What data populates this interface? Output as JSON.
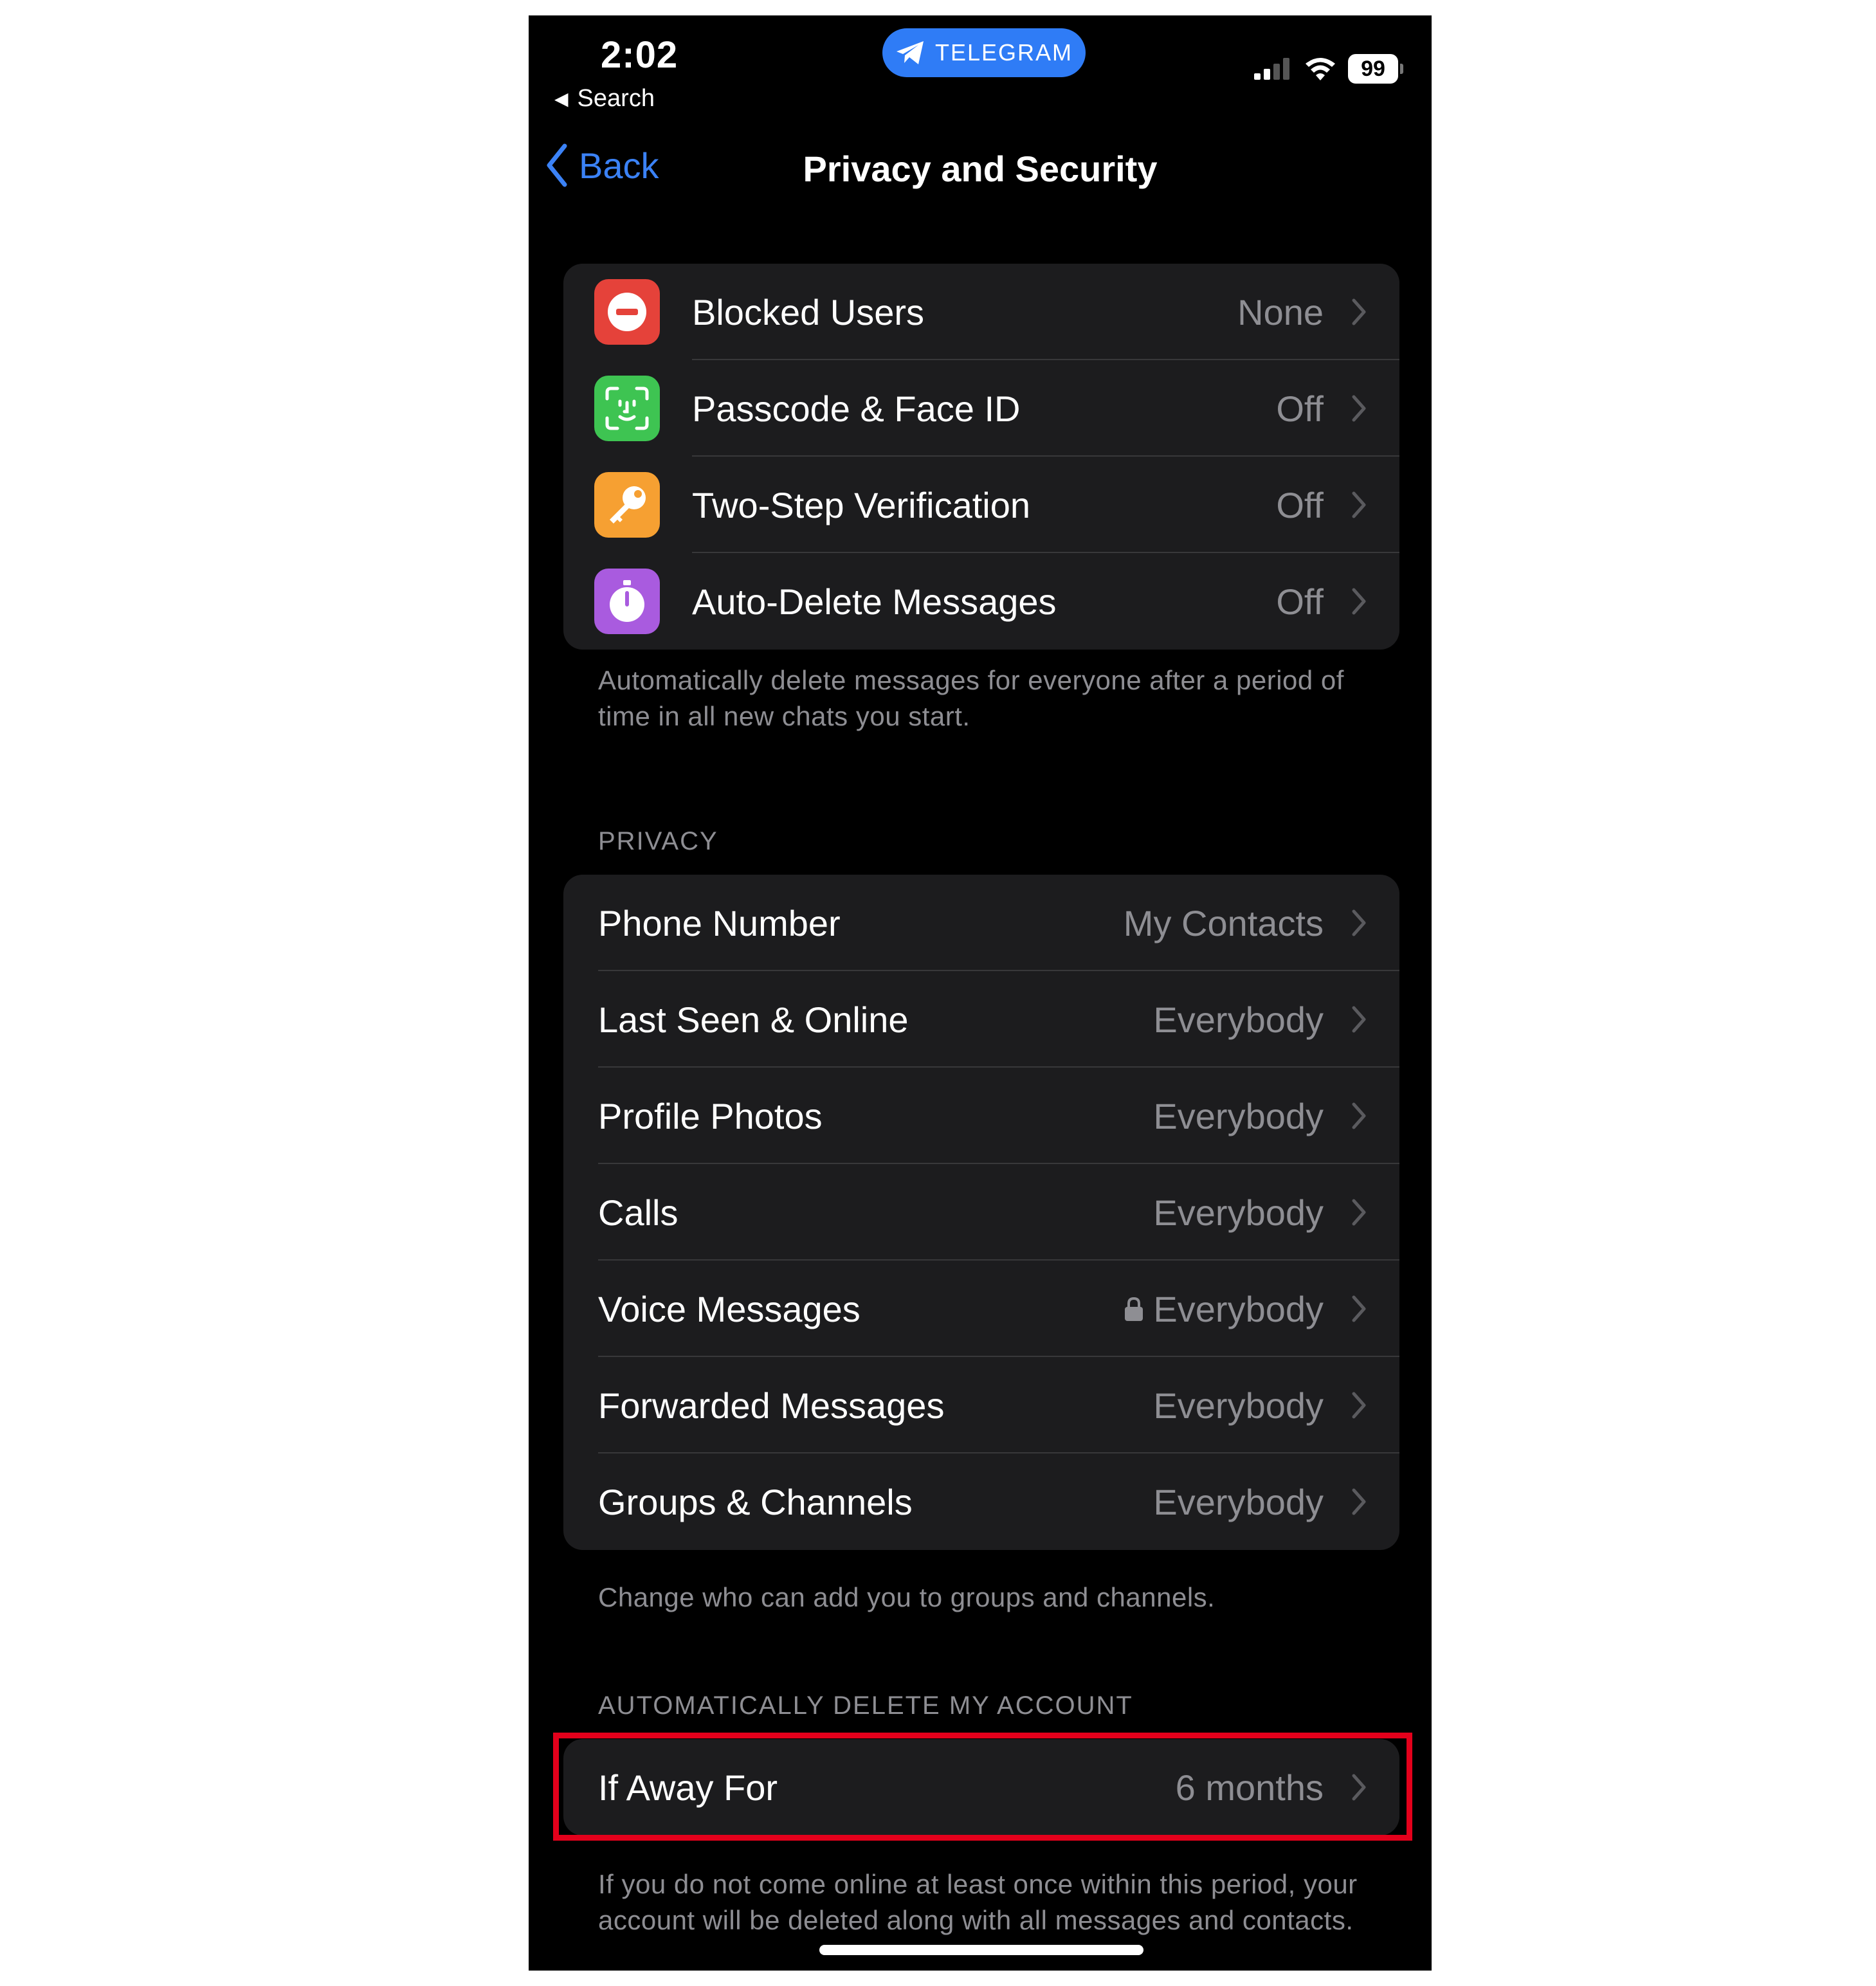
{
  "status_bar": {
    "time": "2:02",
    "back_app": "Search",
    "app_pill": "TELEGRAM",
    "battery": "99",
    "pill_color": "#2f7cf6"
  },
  "nav": {
    "back_label": "Back",
    "title": "Privacy and Security",
    "accent": "#3b82f6"
  },
  "security": {
    "items": [
      {
        "label": "Blocked Users",
        "value": "None",
        "icon": "blocked-icon",
        "color": "#e5423a"
      },
      {
        "label": "Passcode & Face ID",
        "value": "Off",
        "icon": "face-id-icon",
        "color": "#3ec452"
      },
      {
        "label": "Two-Step Verification",
        "value": "Off",
        "icon": "key-icon",
        "color": "#f6a032"
      },
      {
        "label": "Auto-Delete Messages",
        "value": "Off",
        "icon": "timer-icon",
        "color": "#a95bdf"
      }
    ],
    "footer": "Automatically delete messages for everyone after a period of time in all new chats you start."
  },
  "privacy": {
    "header": "PRIVACY",
    "items": [
      {
        "label": "Phone Number",
        "value": "My Contacts"
      },
      {
        "label": "Last Seen & Online",
        "value": "Everybody"
      },
      {
        "label": "Profile Photos",
        "value": "Everybody"
      },
      {
        "label": "Calls",
        "value": "Everybody"
      },
      {
        "label": "Voice Messages",
        "value": "Everybody",
        "locked": true
      },
      {
        "label": "Forwarded Messages",
        "value": "Everybody"
      },
      {
        "label": "Groups & Channels",
        "value": "Everybody"
      }
    ],
    "footer": "Change who can add you to groups and channels."
  },
  "account": {
    "header": "AUTOMATICALLY DELETE MY ACCOUNT",
    "items": [
      {
        "label": "If Away For",
        "value": "6 months"
      }
    ],
    "footer": "If you do not come online at least once within this period, your account will be deleted along with all messages and contacts.",
    "highlight_color": "#e3001b"
  }
}
